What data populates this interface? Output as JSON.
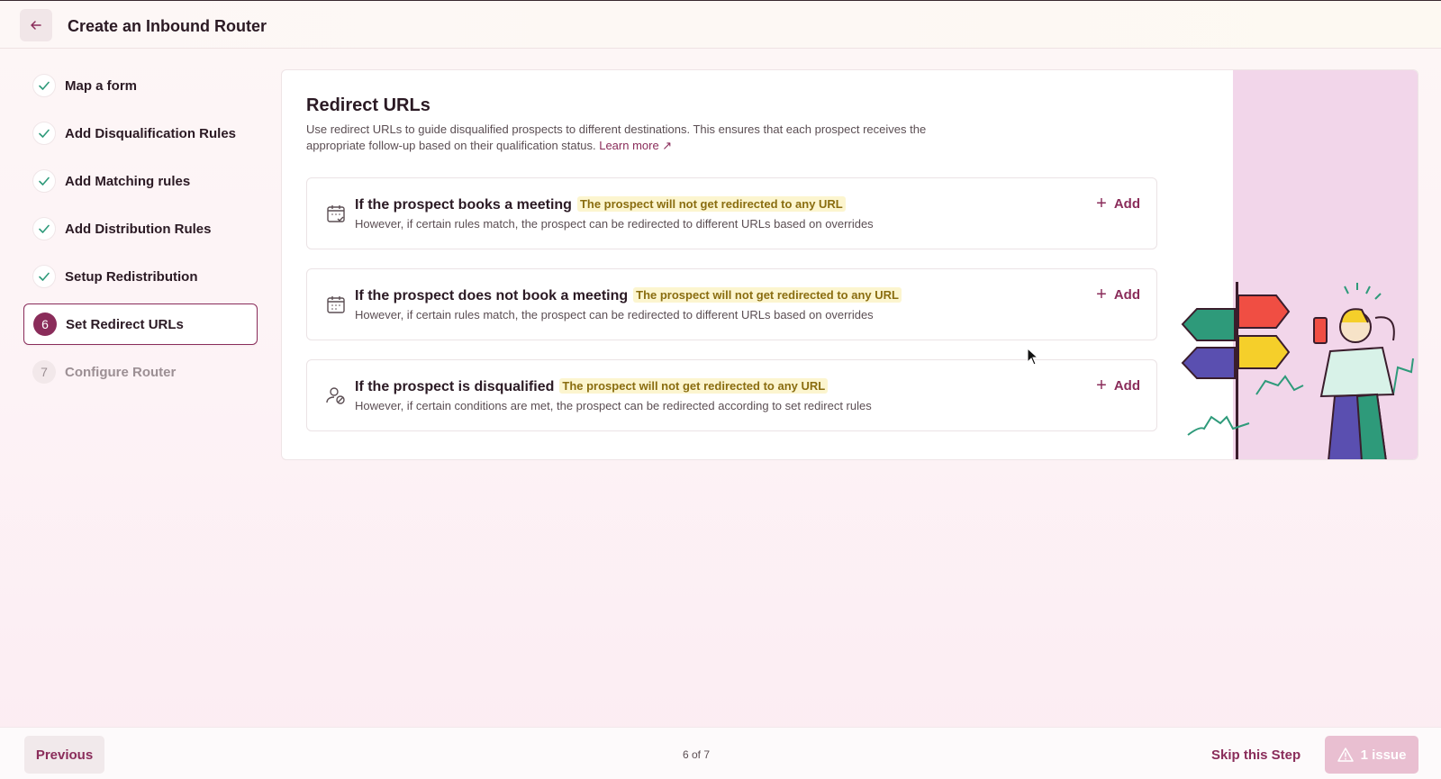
{
  "header": {
    "back_icon": "arrow-left-icon",
    "title": "Create an Inbound Router"
  },
  "steps": [
    {
      "label": "Map a form",
      "status": "done",
      "number": "1"
    },
    {
      "label": "Add Disqualification Rules",
      "status": "done",
      "number": "2"
    },
    {
      "label": "Add Matching rules",
      "status": "done",
      "number": "3"
    },
    {
      "label": "Add Distribution Rules",
      "status": "done",
      "number": "4"
    },
    {
      "label": "Setup Redistribution",
      "status": "done",
      "number": "5"
    },
    {
      "label": "Set Redirect URLs",
      "status": "active",
      "number": "6"
    },
    {
      "label": "Configure Router",
      "status": "pending",
      "number": "7"
    }
  ],
  "section": {
    "title": "Redirect URLs",
    "description": "Use redirect URLs to guide disqualified prospects to different destinations. This ensures that each prospect receives the appropriate follow-up based on their qualification status.",
    "learn_more": "Learn more ↗"
  },
  "rules": [
    {
      "icon": "calendar-check-icon",
      "title": "If the prospect books a meeting",
      "tag": "The prospect will not get redirected to any URL",
      "subtitle": "However, if certain rules match, the prospect can be redirected to different URLs based on overrides",
      "action": "Add"
    },
    {
      "icon": "calendar-x-icon",
      "title": "If the prospect does not book a meeting",
      "tag": "The prospect will not get redirected to any URL",
      "subtitle": "However, if certain rules match, the prospect can be redirected to different URLs based on overrides",
      "action": "Add"
    },
    {
      "icon": "user-block-icon",
      "title": "If the prospect is disqualified",
      "tag": "The prospect will not get redirected to any URL",
      "subtitle": "However, if certain conditions are met, the prospect can be redirected according to set redirect rules",
      "action": "Add"
    }
  ],
  "footer": {
    "previous": "Previous",
    "progress": "6 of 7",
    "skip": "Skip this Step",
    "issues": "1 issue"
  },
  "colors": {
    "accent": "#8a2c5a",
    "tag_bg": "#fcf5cf",
    "tag_text": "#8a6d10",
    "illustration_bg": "#f2d6ea",
    "check": "#2e9a7a"
  }
}
